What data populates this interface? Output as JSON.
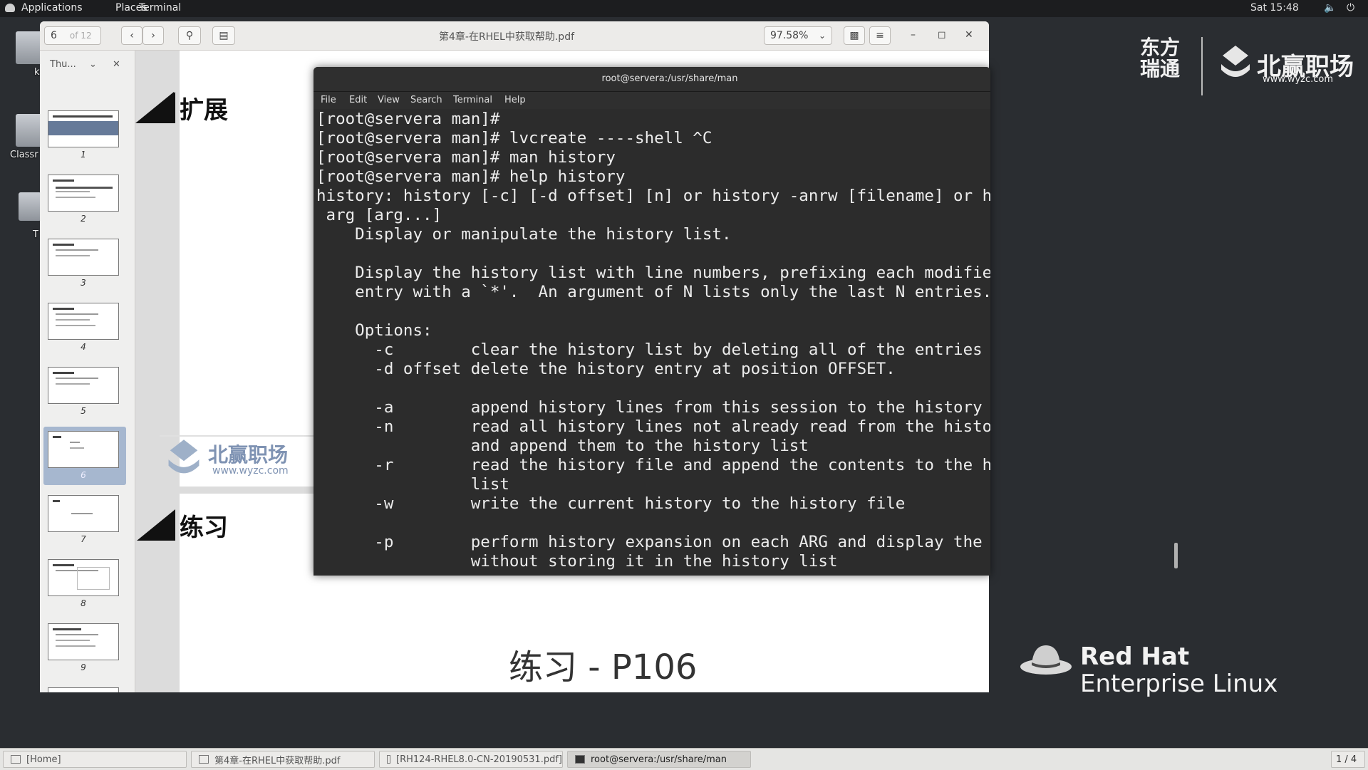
{
  "top_panel": {
    "menus": [
      "Applications",
      "Places",
      "Terminal"
    ],
    "clock": "Sat 15:48"
  },
  "desktop": {
    "icons": [
      "k",
      "Classr",
      "T"
    ]
  },
  "branding": {
    "dongfang_line1": "东方",
    "dongfang_line2": "瑞通",
    "zhiying_name": "北赢职场",
    "zhiying_url": "www.wyzc.com",
    "redhat_line1": "Red Hat",
    "redhat_line2": "Enterprise Linux"
  },
  "pdf": {
    "page_input": "6",
    "page_total": "of 12",
    "title": "第4章-在RHEL中获取帮助.pdf",
    "zoom": "97.58%",
    "sidebar_mode": "Thu...",
    "thumbnail_pages": [
      "1",
      "2",
      "3",
      "4",
      "5",
      "6",
      "7",
      "8",
      "9"
    ],
    "selected_page": "6",
    "heading_extend": "扩展",
    "heading_practice": "练习",
    "watermark_name": "北赢职场",
    "watermark_url": "www.wyzc.com",
    "cut_heading": "练习 - P106"
  },
  "terminal": {
    "title": "root@servera:/usr/share/man",
    "menu": [
      "File",
      "Edit",
      "View",
      "Search",
      "Terminal",
      "Help"
    ],
    "lines": [
      "[root@servera man]#",
      "[root@servera man]# lvcreate ----shell ^C",
      "[root@servera man]# man history",
      "[root@servera man]# help history",
      "history: history [-c] [-d offset] [n] or history -anrw [filename] or history -ps",
      " arg [arg...]",
      "    Display or manipulate the history list.",
      "",
      "    Display the history list with line numbers, prefixing each modified",
      "    entry with a `*'.  An argument of N lists only the last N entries.",
      "",
      "    Options:",
      "      -c        clear the history list by deleting all of the entries",
      "      -d offset delete the history entry at position OFFSET.",
      "",
      "      -a        append history lines from this session to the history file",
      "      -n        read all history lines not already read from the history file",
      "                and append them to the history list",
      "      -r        read the history file and append the contents to the history",
      "                list",
      "      -w        write the current history to the history file",
      "",
      "      -p        perform history expansion on each ARG and display the result",
      "                without storing it in the history list"
    ]
  },
  "taskbar": {
    "tasks": [
      "[Home]",
      "第4章-在RHEL中获取帮助.pdf",
      "[RH124-RHEL8.0-CN-20190531.pdf]",
      "root@servera:/usr/share/man"
    ],
    "workspace": "1 / 4"
  }
}
